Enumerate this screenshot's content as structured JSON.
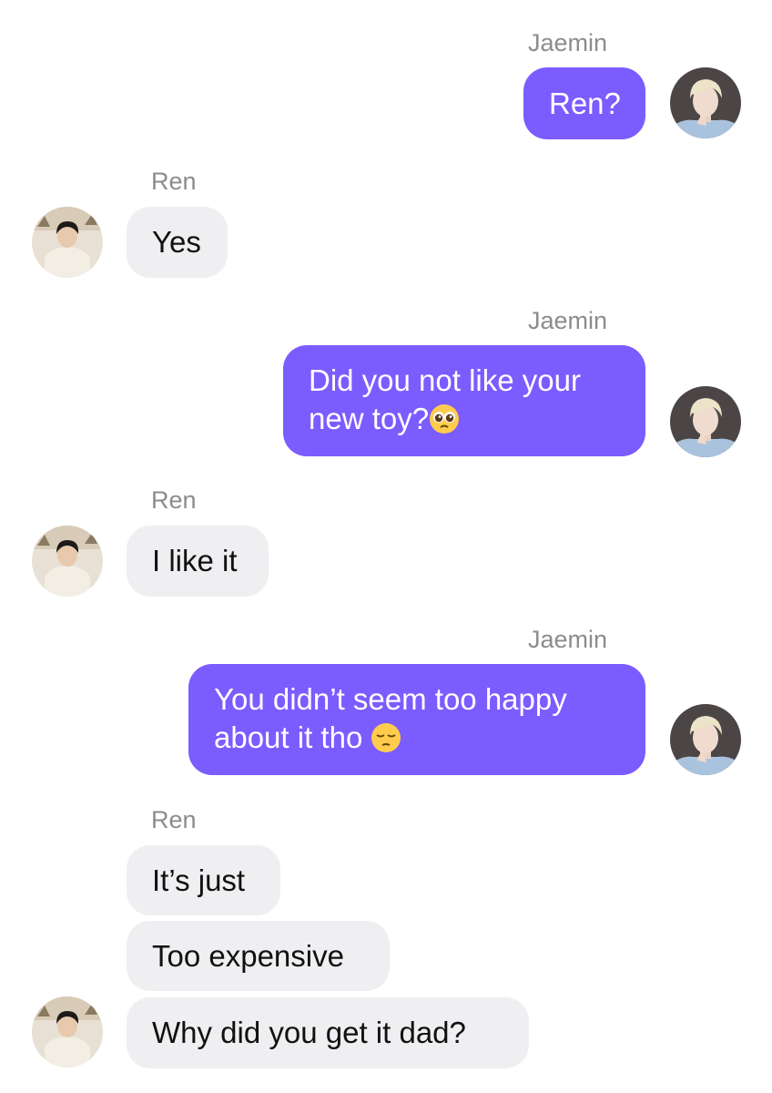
{
  "conversation": {
    "participants": {
      "jaemin": {
        "name": "Jaemin",
        "avatar_icon": "blonde-person-avatar-icon"
      },
      "ren": {
        "name": "Ren",
        "avatar_icon": "child-person-avatar-icon"
      }
    },
    "messages": [
      {
        "sender": "Jaemin",
        "side": "right",
        "text": "Ren?"
      },
      {
        "sender": "Ren",
        "side": "left",
        "text": "Yes"
      },
      {
        "sender": "Jaemin",
        "side": "right",
        "line1": "Did you not like your",
        "line2": "new toy?",
        "emoji": "pleading-face-emoji"
      },
      {
        "sender": "Ren",
        "side": "left",
        "text": "I like it"
      },
      {
        "sender": "Jaemin",
        "side": "right",
        "line1": "You didn’t seem too happy",
        "line2": "about it tho",
        "emoji": "pensive-face-emoji"
      },
      {
        "sender": "Ren",
        "side": "left",
        "text": "It’s just"
      },
      {
        "sender": "Ren",
        "side": "left",
        "text": "Too expensive"
      },
      {
        "sender": "Ren",
        "side": "left",
        "text": "Why did you get it dad?"
      }
    ]
  },
  "colors": {
    "outgoing_bubble": "#7b5cff",
    "incoming_bubble": "#efeff2",
    "sender_name": "#8b8b90"
  }
}
